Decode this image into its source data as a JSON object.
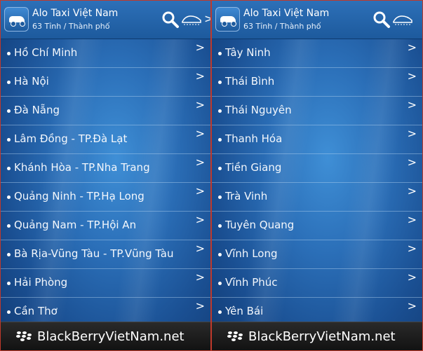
{
  "panels": [
    {
      "title": "Alo Taxi Việt Nam",
      "subtitle": "63 Tỉnh / Thành phố",
      "items": [
        {
          "label": "Hồ Chí Minh"
        },
        {
          "label": "Hà Nội"
        },
        {
          "label": "Đà Nẵng"
        },
        {
          "label": "Lâm Đồng - TP.Đà Lạt"
        },
        {
          "label": "Khánh Hòa - TP.Nha Trang"
        },
        {
          "label": "Quảng Ninh - TP.Hạ Long"
        },
        {
          "label": "Quảng Nam - TP.Hội An"
        },
        {
          "label": "Bà Rịa-Vũng Tàu - TP.Vũng Tàu"
        },
        {
          "label": "Hải Phòng"
        },
        {
          "label": "Cần Thơ"
        }
      ],
      "footer": "BlackBerryVietNam.net"
    },
    {
      "title": "Alo Taxi Việt Nam",
      "subtitle": "63 Tỉnh / Thành phố",
      "items": [
        {
          "label": "Tây Ninh"
        },
        {
          "label": "Thái Bình"
        },
        {
          "label": "Thái Nguyên"
        },
        {
          "label": "Thanh Hóa"
        },
        {
          "label": "Tiền Giang"
        },
        {
          "label": "Trà Vinh"
        },
        {
          "label": "Tuyên Quang"
        },
        {
          "label": "Vĩnh Long"
        },
        {
          "label": "Vĩnh Phúc"
        },
        {
          "label": "Yên Bái"
        }
      ],
      "footer": "BlackBerryVietNam.net"
    }
  ],
  "icons": {
    "app": "taxi-car-icon",
    "search": "search-icon",
    "logo": "taxi-logo-icon",
    "chevron": "chevron-right-icon",
    "footer": "blackberry-icon"
  },
  "chevron_glyph": ">",
  "colors": {
    "background": "#2b6fb8",
    "header": "#1d5a9d",
    "footer": "#121212",
    "text": "#ffffff"
  }
}
